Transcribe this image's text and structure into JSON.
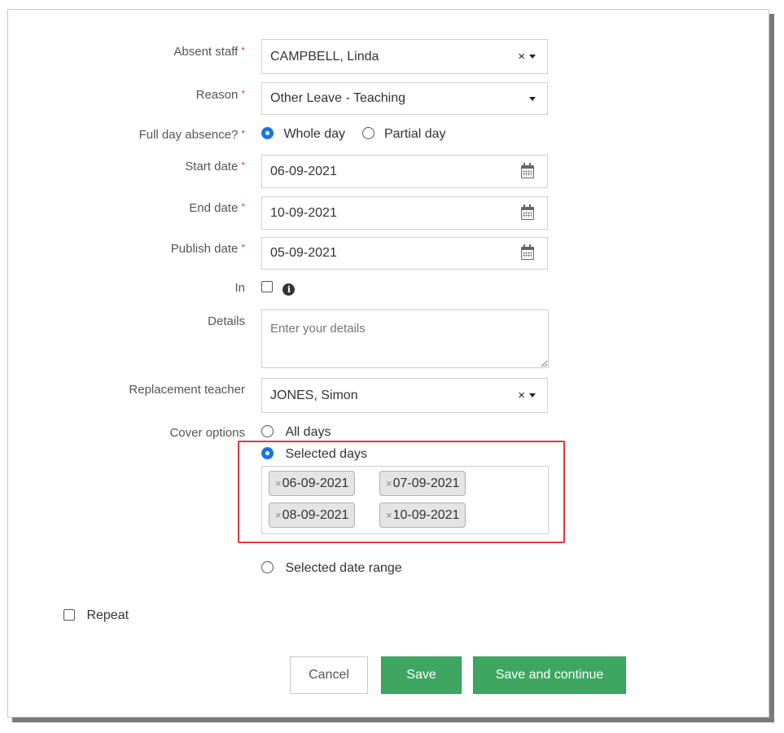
{
  "form": {
    "absent_staff": {
      "label": "Absent staff",
      "required": "*",
      "value": "CAMPBELL, Linda"
    },
    "reason": {
      "label": "Reason",
      "required": "*",
      "value": "Other Leave - Teaching"
    },
    "full_day": {
      "label": "Full day absence?",
      "required": "*",
      "opt_whole": "Whole day",
      "opt_partial": "Partial day",
      "selected": "Whole day"
    },
    "start_date": {
      "label": "Start date",
      "required": "*",
      "value": "06-09-2021"
    },
    "end_date": {
      "label": "End date",
      "required": "*",
      "value": "10-09-2021"
    },
    "publish_date": {
      "label": "Publish date",
      "required": "*",
      "value": "05-09-2021"
    },
    "in": {
      "label": "In"
    },
    "details": {
      "label": "Details",
      "placeholder": "Enter your details"
    },
    "replacement": {
      "label": "Replacement teacher",
      "value": "JONES, Simon"
    },
    "cover": {
      "label": "Cover options",
      "opt_all": "All days",
      "opt_selected": "Selected days",
      "opt_range": "Selected date range",
      "selected": "Selected days",
      "tags": [
        "06-09-2021",
        "07-09-2021",
        "08-09-2021",
        "10-09-2021"
      ]
    },
    "repeat": {
      "label": "Repeat"
    }
  },
  "icons": {
    "clear": "×",
    "tag_remove": "×"
  },
  "buttons": {
    "cancel": "Cancel",
    "save": "Save",
    "save_continue": "Save and continue"
  },
  "colors": {
    "accent": "#3ea660",
    "highlight": "#e0393e",
    "radio": "#1a73e8",
    "required": "#e0443a"
  }
}
